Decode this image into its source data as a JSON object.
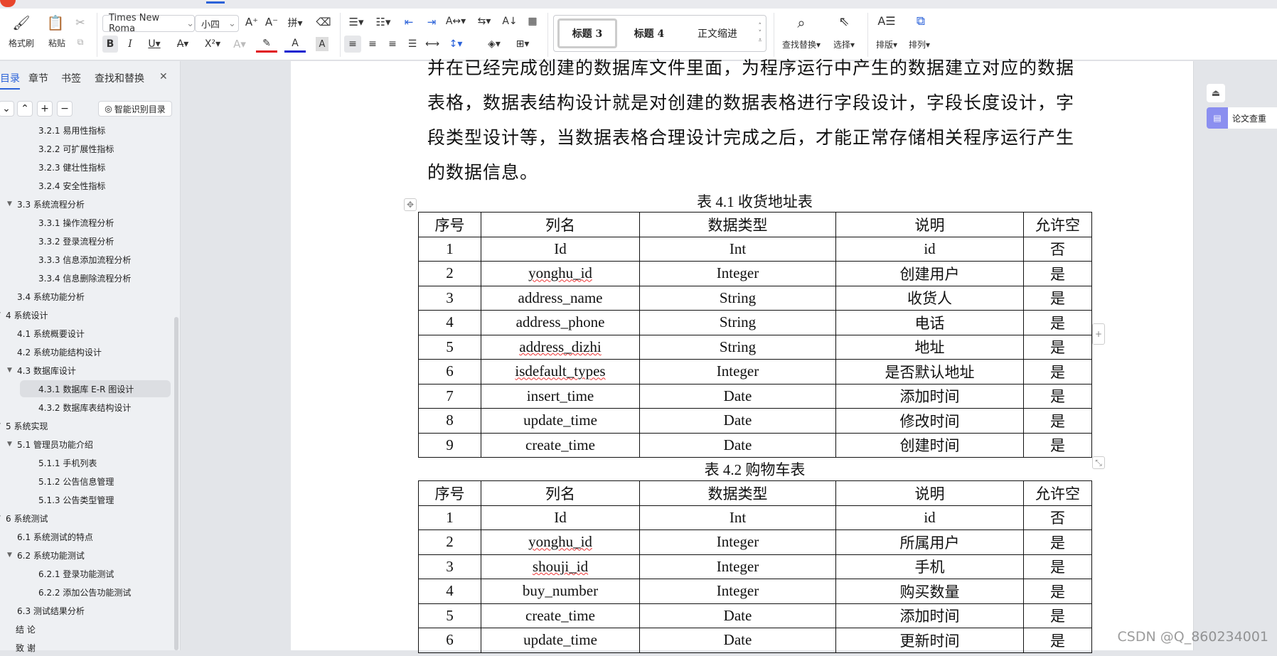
{
  "toolbar": {
    "format_painter": "格式刷",
    "paste": "粘贴",
    "font_name": "Times New Roma",
    "font_size": "小四",
    "bold": "B",
    "italic": "I",
    "underline": "U",
    "styles": [
      "标题 3",
      "标题 4",
      "正文缩进"
    ],
    "find_replace": "查找替换",
    "select": "选择",
    "layout": "排版",
    "arrange": "排列"
  },
  "sidebar": {
    "tabs": [
      "目录",
      "章节",
      "书签",
      "查找和替换"
    ],
    "smart_toc": "智能识别目录",
    "items": [
      {
        "label": "3.2.1  易用性指标",
        "level": 3
      },
      {
        "label": "3.2.2  可扩展性指标",
        "level": 3
      },
      {
        "label": "3.2.3  健壮性指标",
        "level": 3
      },
      {
        "label": "3.2.4  安全性指标",
        "level": 3
      },
      {
        "label": "3.3  系统流程分析",
        "level": 2,
        "expanded": true
      },
      {
        "label": "3.3.1  操作流程分析",
        "level": 3
      },
      {
        "label": "3.3.2  登录流程分析",
        "level": 3
      },
      {
        "label": "3.3.3  信息添加流程分析",
        "level": 3
      },
      {
        "label": "3.3.4  信息删除流程分析",
        "level": 3
      },
      {
        "label": "3.4  系统功能分析",
        "level": 2
      },
      {
        "label": "4  系统设计",
        "level": 1,
        "expanded": true
      },
      {
        "label": "4.1  系统概要设计",
        "level": 2
      },
      {
        "label": "4.2  系统功能结构设计",
        "level": 2
      },
      {
        "label": "4.3  数据库设计",
        "level": 2,
        "expanded": true
      },
      {
        "label": "4.3.1  数据库 E-R 图设计",
        "level": 3,
        "active": true
      },
      {
        "label": "4.3.2  数据库表结构设计",
        "level": 3
      },
      {
        "label": "5  系统实现",
        "level": 1,
        "expanded": true
      },
      {
        "label": "5.1  管理员功能介绍",
        "level": 2,
        "expanded": true
      },
      {
        "label": "5.1.1  手机列表",
        "level": 3
      },
      {
        "label": "5.1.2  公告信息管理",
        "level": 3
      },
      {
        "label": "5.1.3 公告类型管理",
        "level": 3
      },
      {
        "label": "6  系统测试",
        "level": 1,
        "expanded": true
      },
      {
        "label": "6.1  系统测试的特点",
        "level": 2
      },
      {
        "label": "6.2  系统功能测试",
        "level": 2,
        "expanded": true
      },
      {
        "label": "6.2.1  登录功能测试",
        "level": 3
      },
      {
        "label": "6.2.2  添加公告功能测试",
        "level": 3
      },
      {
        "label": "6.3  测试结果分析",
        "level": 2
      },
      {
        "label": "结  论",
        "level": 0
      },
      {
        "label": "致  谢",
        "level": 0
      }
    ]
  },
  "document": {
    "paragraph": [
      "并在已经完成创建的数据库文件里面，为程序运行中产生的数据建立对应的数据",
      "表格，数据表结构设计就是对创建的数据表格进行字段设计，字段长度设计，字",
      "段类型设计等，当数据表格合理设计完成之后，才能正常存储相关程序运行产生",
      "的数据信息。"
    ],
    "tables": [
      {
        "caption": "表 4.1 收货地址表",
        "headers": [
          "序号",
          "列名",
          "数据类型",
          "说明",
          "允许空"
        ],
        "rows": [
          [
            "1",
            "Id",
            "Int",
            "id",
            "否"
          ],
          [
            "2",
            "yonghu_id",
            "Integer",
            "创建用户",
            "是"
          ],
          [
            "3",
            "address_name",
            "String",
            "收货人",
            "是"
          ],
          [
            "4",
            "address_phone",
            "String",
            "电话",
            "是"
          ],
          [
            "5",
            "address_dizhi",
            "String",
            "地址",
            "是"
          ],
          [
            "6",
            "isdefault_types",
            "Integer",
            "是否默认地址",
            "是"
          ],
          [
            "7",
            "insert_time",
            "Date",
            "添加时间",
            "是"
          ],
          [
            "8",
            "update_time",
            "Date",
            "修改时间",
            "是"
          ],
          [
            "9",
            "create_time",
            "Date",
            "创建时间",
            "是"
          ]
        ]
      },
      {
        "caption": "表 4.2 购物车表",
        "headers": [
          "序号",
          "列名",
          "数据类型",
          "说明",
          "允许空"
        ],
        "rows": [
          [
            "1",
            "Id",
            "Int",
            "id",
            "否"
          ],
          [
            "2",
            "yonghu_id",
            "Integer",
            "所属用户",
            "是"
          ],
          [
            "3",
            "shouji_id",
            "Integer",
            "手机",
            "是"
          ],
          [
            "4",
            "buy_number",
            "Integer",
            "购买数量",
            "是"
          ],
          [
            "5",
            "create_time",
            "Date",
            "添加时间",
            "是"
          ],
          [
            "6",
            "update_time",
            "Date",
            "更新时间",
            "是"
          ]
        ]
      }
    ]
  },
  "right_panel": {
    "paper_check": "论文查重"
  },
  "watermark": "CSDN @Q_860234001",
  "colors": {
    "accent": "#2b62d9",
    "paper_check": "#8b8ff0"
  }
}
